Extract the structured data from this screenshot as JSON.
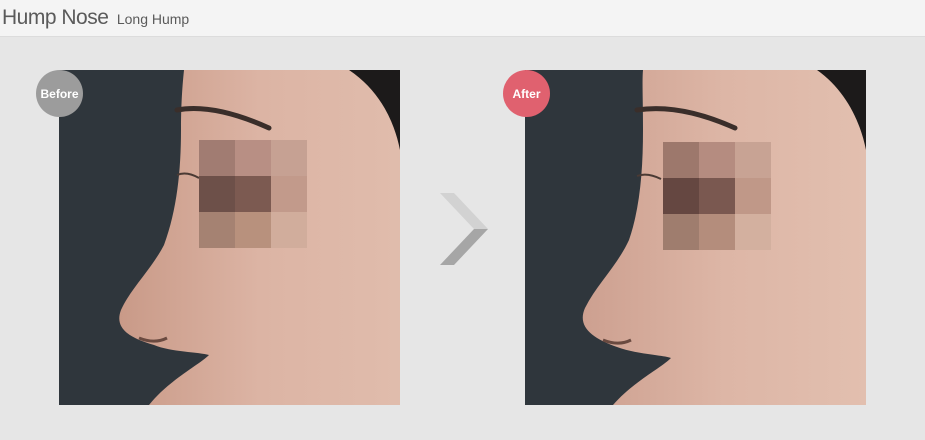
{
  "header": {
    "title": "Hump Nose",
    "subtitle": "Long Hump"
  },
  "before": {
    "badge_label": "Before",
    "badge_color": "#9c9c9c"
  },
  "after": {
    "badge_label": "After",
    "badge_color": "#e0616f"
  },
  "colors": {
    "background": "#e6e6e6",
    "header_bg": "#f4f4f4",
    "title_text": "#5a5a5a",
    "photo_backdrop": "#2f363c",
    "skin": "#d8b0a0",
    "arrow_light": "#d2d2d2",
    "arrow_dark": "#a6a6a6"
  },
  "icons": {
    "arrow": "chevron-right-icon"
  }
}
